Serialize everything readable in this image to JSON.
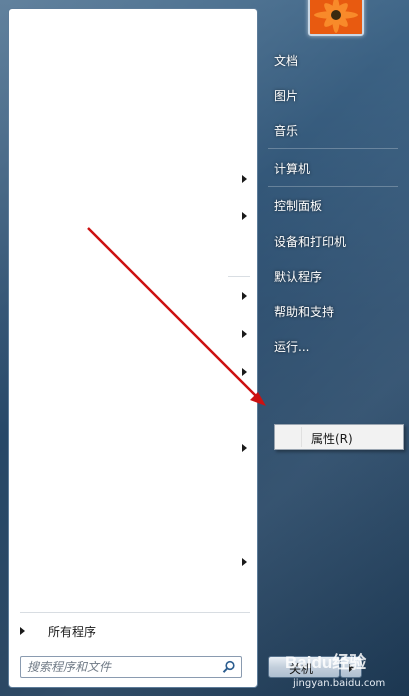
{
  "right_menu": {
    "documents": "文档",
    "pictures": "图片",
    "music": "音乐",
    "computer": "计算机",
    "control_panel": "控制面板",
    "devices_printers": "设备和打印机",
    "default_programs": "默认程序",
    "help_support": "帮助和支持",
    "run": "运行..."
  },
  "context_menu": {
    "properties": "属性(R)"
  },
  "all_programs": "所有程序",
  "search": {
    "placeholder": "搜索程序和文件"
  },
  "shutdown": {
    "label": "关机"
  },
  "watermark": {
    "brand": "Baidu经验",
    "url": "jingyan.baidu.com"
  },
  "colors": {
    "annotation_arrow": "#cc1111",
    "menu_background": "#2b4d6e"
  },
  "icons": [
    "search-icon",
    "submenu-arrow-icon",
    "user-avatar",
    "annotation-arrow"
  ]
}
